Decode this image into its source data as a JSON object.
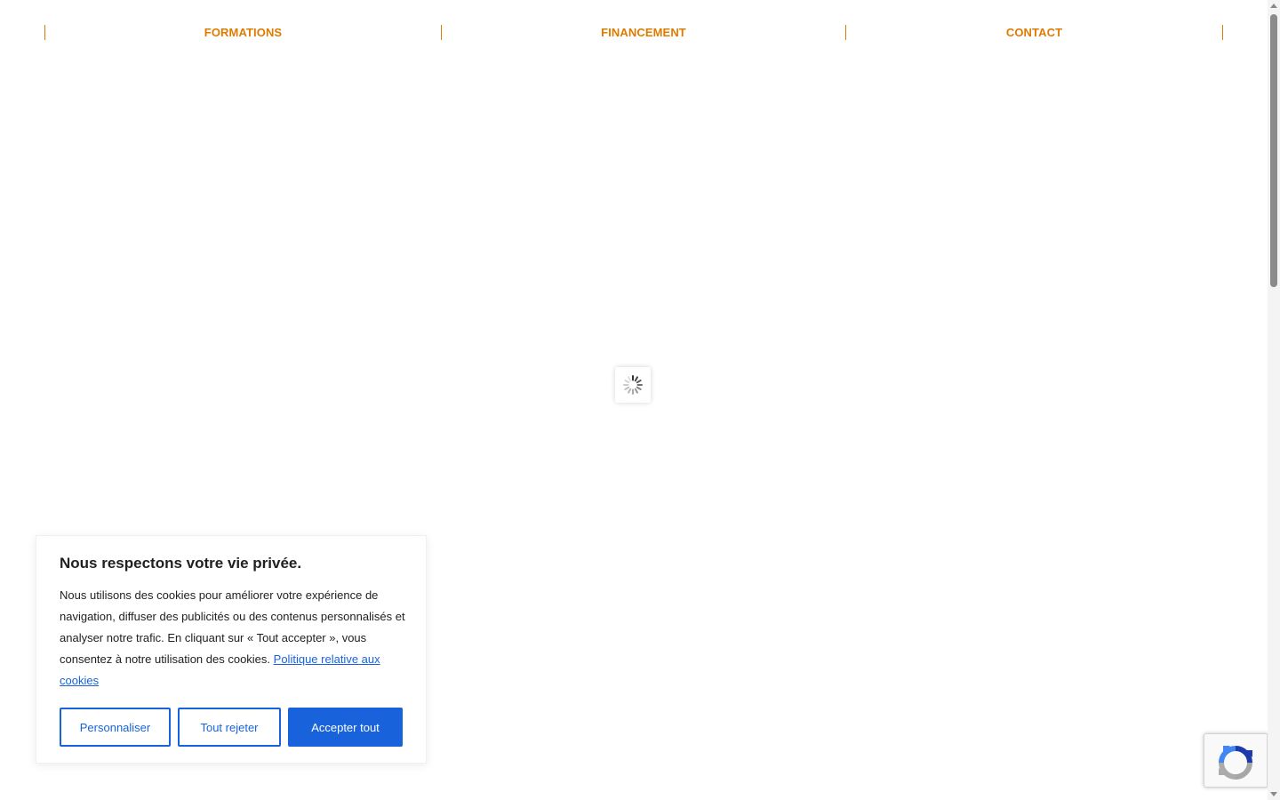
{
  "nav": {
    "items": [
      {
        "label": "FORMATIONS"
      },
      {
        "label": "FINANCEMENT"
      },
      {
        "label": "CONTACT"
      }
    ],
    "accent_color": "#e07b00"
  },
  "loader": {
    "icon": "spinner-icon"
  },
  "cookie_banner": {
    "title": "Nous respectons votre vie privée.",
    "text": "Nous utilisons des cookies pour améliorer votre expérience de navigation, diffuser des publicités ou des contenus personnalisés et analyser notre trafic. En cliquant sur « Tout accepter », vous consentez à notre utilisation des cookies.",
    "policy_link": "Politique relative aux cookies",
    "buttons": {
      "customize": "Personnaliser",
      "reject": "Tout rejeter",
      "accept": "Accepter tout"
    },
    "accent_color": "#1863dc"
  },
  "recaptcha": {
    "icon": "recaptcha-icon"
  }
}
